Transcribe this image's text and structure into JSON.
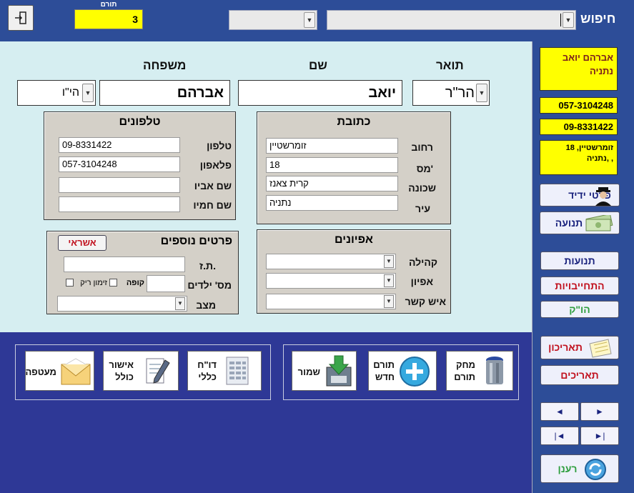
{
  "top": {
    "search_label": "חיפוש",
    "search_value": "",
    "secondary_select": "",
    "counter_caption": "תורם",
    "counter_value": "3"
  },
  "names": {
    "title_header": "תואר",
    "first_header": "שם",
    "last_header": "משפחה",
    "title_value": "הר\"ר",
    "first_value": "יואב",
    "last_value": "אברהם",
    "suffix_value": "הי\"ו"
  },
  "address": {
    "header": "כתובת",
    "street_label": "רחוב",
    "street_value": "זומרשטיין",
    "number_label": "מס'",
    "number_value": "18",
    "neighborhood_label": "שכונה",
    "neighborhood_value": "קרית צאנז",
    "city_label": "עיר",
    "city_value": "נתניה"
  },
  "phones": {
    "header": "טלפונים",
    "phone_label": "טלפון",
    "phone_value": "09-8331422",
    "mobile_label": "פלאפון",
    "mobile_value": "057-3104248",
    "father_label": "שם אביו",
    "father_value": "",
    "fatherinlaw_label": "שם חמיו",
    "fatherinlaw_value": ""
  },
  "traits": {
    "header": "אפיונים",
    "community_label": "קהילה",
    "trait_label": "אפיון",
    "contact_label": "איש קשר"
  },
  "extra": {
    "header": "פרטים נוספים",
    "credit_button": "אשראי",
    "id_label": "ת.ז.",
    "children_label": "מס' ילדים",
    "cashbox_label": "קופה",
    "empty_sched_label": "זימון ריק",
    "status_label": "מצב"
  },
  "bottom_buttons": {
    "delete_donor": "מחק תורם",
    "new_donor": "תורם חדש",
    "save": "שמור",
    "report": "דו\"ח כללי",
    "approval": "אישור כולל",
    "envelope": "מעטפה"
  },
  "sidebar": {
    "name_box": "אברהם יואב נתניה",
    "mobile_box": "057-3104248",
    "phone_box": "09-8331422",
    "address_box": "זומרשטיין, 18 נתניה, ,",
    "friend_btn": "פרטי ידיד",
    "movement_btn": "תנועה",
    "movements_btn": "תנועות",
    "commitments_btn": "התחייבויות",
    "standing_order_btn": "הו\"ק",
    "reminder_btn": "תאריכון",
    "dates_btn": "תאריכים",
    "nav_prev": "◄",
    "nav_next": "►",
    "nav_first": "|◄",
    "nav_last": "►|",
    "refresh_btn": "רענן"
  },
  "colors": {
    "highlight": "#ffff00",
    "commitments_red": "#c1121f",
    "standing_green": "#2e9e3e"
  }
}
